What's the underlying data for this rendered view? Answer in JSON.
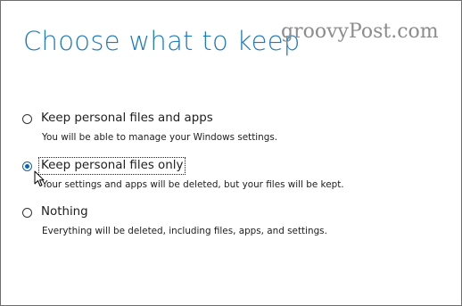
{
  "page": {
    "title": "Choose what to keep",
    "watermark": "groovyPost.com"
  },
  "options": [
    {
      "label": "Keep personal files and apps",
      "description": "You will be able to manage your Windows settings.",
      "selected": false
    },
    {
      "label": "Keep personal files only",
      "description": "Your settings and apps will be deleted, but your files will be kept.",
      "selected": true
    },
    {
      "label": "Nothing",
      "description": "Everything will be deleted, including files, apps, and settings.",
      "selected": false
    }
  ],
  "colors": {
    "title": "#1c7ac0",
    "selected_radio": "#0a64b4",
    "text": "#202020"
  }
}
